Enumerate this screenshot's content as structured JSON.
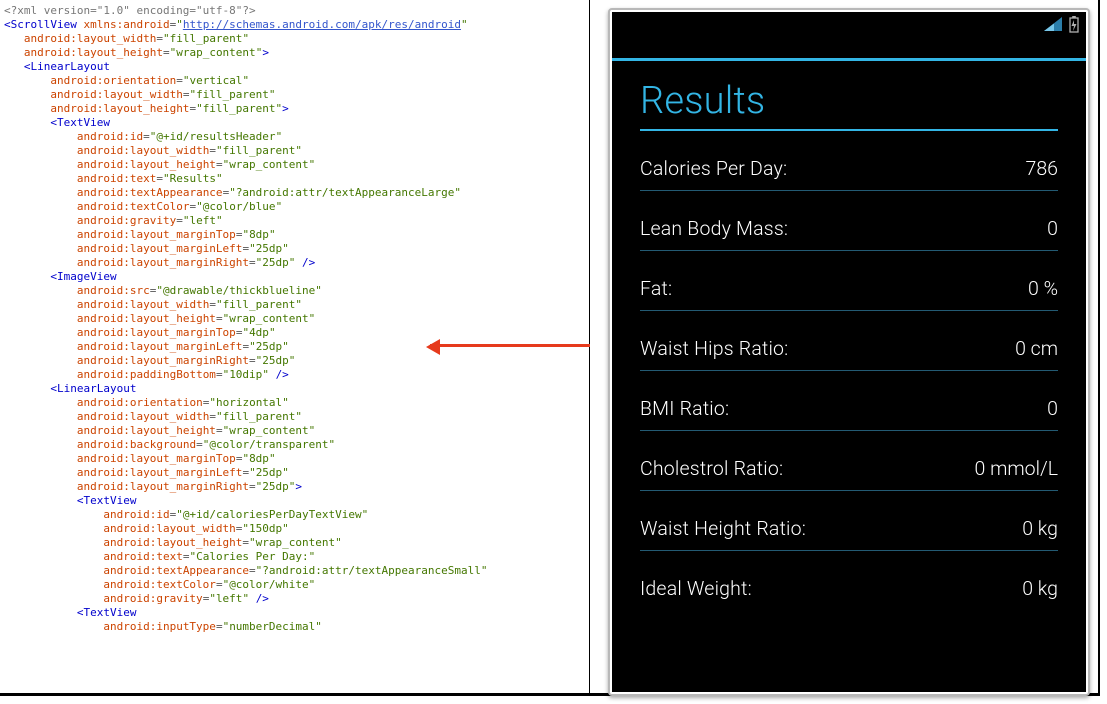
{
  "xml": {
    "declaration": "<?xml version=\"1.0\" encoding=\"utf-8\"?>",
    "rootTag": "ScrollView",
    "xmlns": "http://schemas.android.com/apk/res/android",
    "rootAttrs": {
      "layout_width": "fill_parent",
      "layout_height": "wrap_content"
    },
    "linearLayoutAttrs": {
      "orientation": "vertical",
      "layout_width": "fill_parent",
      "layout_height": "fill_parent"
    },
    "textViewHeaderAttrs": {
      "id": "@+id/resultsHeader",
      "layout_width": "fill_parent",
      "layout_height": "wrap_content",
      "text": "Results",
      "textAppearance": "?android:attr/textAppearanceLarge",
      "textColor": "@color/blue",
      "gravity": "left",
      "layout_marginTop": "8dp",
      "layout_marginLeft": "25dp",
      "layout_marginRight": "25dp"
    },
    "imageViewAttrs": {
      "src": "@drawable/thickblueline",
      "layout_width": "fill_parent",
      "layout_height": "wrap_content",
      "layout_marginTop": "4dp",
      "layout_marginLeft": "25dp",
      "layout_marginRight": "25dp",
      "paddingBottom": "10dip"
    },
    "innerLinearAttrs": {
      "orientation": "horizontal",
      "layout_width": "fill_parent",
      "layout_height": "wrap_content",
      "background": "@color/transparent",
      "layout_marginTop": "8dp",
      "layout_marginLeft": "25dp",
      "layout_marginRight": "25dp"
    },
    "caloriesTextViewAttrs": {
      "id": "@+id/caloriesPerDayTextView",
      "layout_width": "150dp",
      "layout_height": "wrap_content",
      "text": "Calories Per Day:",
      "textAppearance": "?android:attr/textAppearanceSmall",
      "textColor": "@color/white",
      "gravity": "left"
    },
    "trailingTextViewAttrs": {
      "inputType": "numberDecimal"
    }
  },
  "app": {
    "header": "Results",
    "rows": [
      {
        "label": "Calories Per Day:",
        "value": "786"
      },
      {
        "label": "Lean Body Mass:",
        "value": "0"
      },
      {
        "label": "Fat:",
        "value": "0 %"
      },
      {
        "label": "Waist Hips Ratio:",
        "value": "0 cm"
      },
      {
        "label": "BMI Ratio:",
        "value": "0"
      },
      {
        "label": "Cholestrol Ratio:",
        "value": "0 mmol/L"
      },
      {
        "label": "Waist Height Ratio:",
        "value": "0 kg"
      },
      {
        "label": "Ideal Weight:",
        "value": "0 kg"
      }
    ]
  },
  "colors": {
    "holoBlue": "#33b5e5",
    "dividerBlue": "#235a73"
  }
}
